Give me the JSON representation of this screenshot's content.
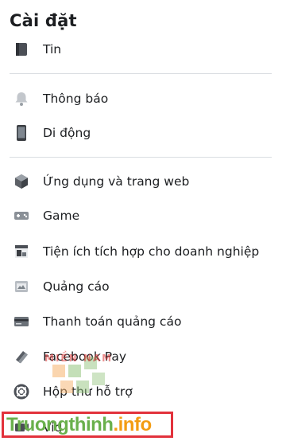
{
  "page": {
    "title": "Cài đặt"
  },
  "menu": {
    "items": [
      {
        "label": "Tin"
      },
      {
        "label": "Thông báo"
      },
      {
        "label": "Di động"
      },
      {
        "label": "Ứng dụng và trang web"
      },
      {
        "label": "Game"
      },
      {
        "label": "Tiện ích tích hợp cho doanh nghiệp"
      },
      {
        "label": "Quảng cáo"
      },
      {
        "label": "Thanh toán quảng cáo"
      },
      {
        "label": "Facebook Pay"
      },
      {
        "label": "Hộp thư hỗ trợ"
      },
      {
        "label": "Vid"
      }
    ]
  },
  "watermark": {
    "text_main": "Truongthinh",
    "text_suffix": ".info",
    "red_text": "MIỀN NAM"
  },
  "colors": {
    "divider": "#dadde1",
    "text": "#1c1e21",
    "icon_gray": "#606770",
    "wm_green": "#6ab04c",
    "wm_orange": "#f39c12",
    "wm_red": "#e2323c"
  }
}
